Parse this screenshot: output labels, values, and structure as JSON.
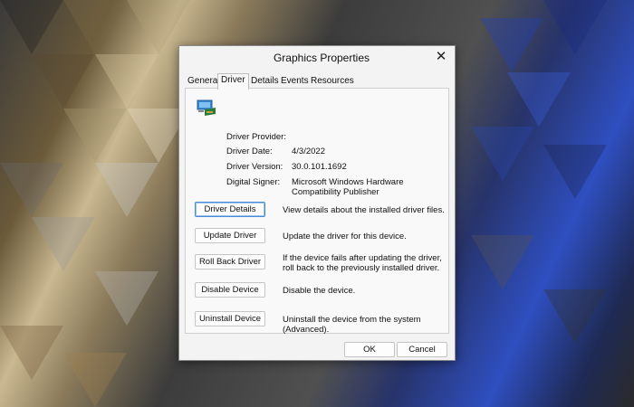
{
  "window": {
    "title": "Graphics Properties"
  },
  "tabs": [
    {
      "label": "General"
    },
    {
      "label": "Driver"
    },
    {
      "label": "Details"
    },
    {
      "label": "Events"
    },
    {
      "label": "Resources"
    }
  ],
  "active_tab": "Driver",
  "driver_info": {
    "provider_label": "Driver Provider:",
    "provider_value": "",
    "date_label": "Driver Date:",
    "date_value": "4/3/2022",
    "version_label": "Driver Version:",
    "version_value": "30.0.101.1692",
    "signer_label": "Digital Signer:",
    "signer_value": "Microsoft Windows Hardware Compatibility Publisher"
  },
  "actions": [
    {
      "label": "Driver Details",
      "description": "View details about the installed driver files."
    },
    {
      "label": "Update Driver",
      "description": "Update the driver for this device."
    },
    {
      "label": "Roll Back Driver",
      "description": "If the device fails after updating the driver, roll back to the previously installed driver."
    },
    {
      "label": "Disable Device",
      "description": "Disable the device."
    },
    {
      "label": "Uninstall Device",
      "description": "Uninstall the device from the system (Advanced)."
    }
  ],
  "footer": {
    "ok_label": "OK",
    "cancel_label": "Cancel"
  },
  "icons": {
    "close": "close-icon",
    "device": "display-adapter-icon"
  },
  "colors": {
    "focus_border": "#4a8ad8",
    "dialog_bg": "#f3f3f3"
  }
}
